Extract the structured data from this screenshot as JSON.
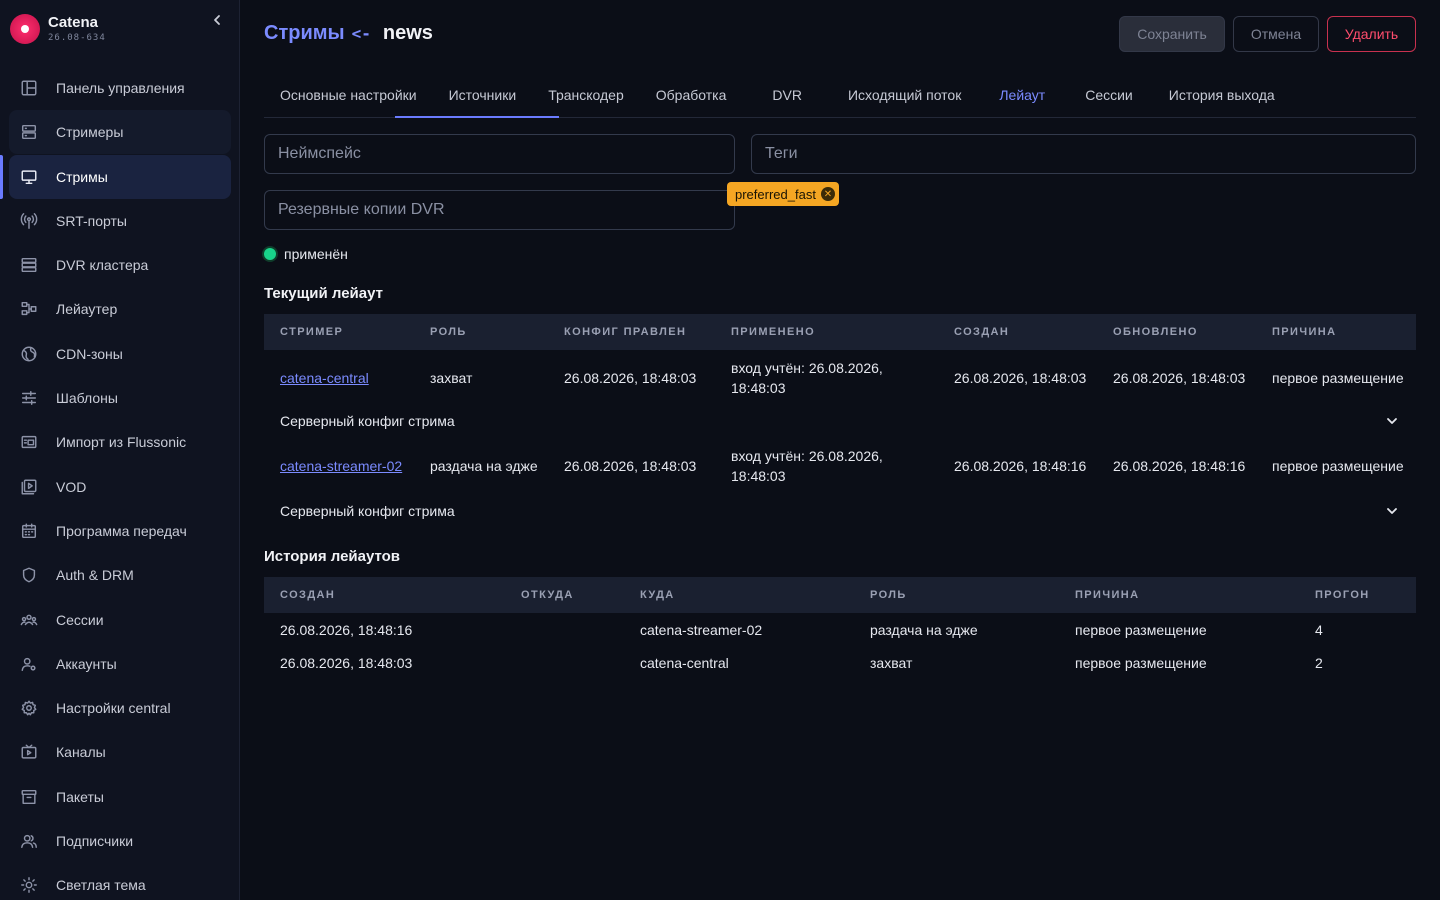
{
  "brand": {
    "name": "Catena",
    "version": "26.08-634"
  },
  "sidebar": {
    "items": [
      {
        "label": "Панель управления",
        "icon": "dashboard-icon"
      },
      {
        "label": "Стримеры",
        "icon": "servers-icon"
      },
      {
        "label": "Стримы",
        "icon": "monitor-icon"
      },
      {
        "label": "SRT-порты",
        "icon": "antenna-icon"
      },
      {
        "label": "DVR кластера",
        "icon": "storage-icon"
      },
      {
        "label": "Лейаутер",
        "icon": "layout-icon"
      },
      {
        "label": "CDN-зоны",
        "icon": "globe-icon"
      },
      {
        "label": "Шаблоны",
        "icon": "sliders-icon"
      },
      {
        "label": "Импорт из Flussonic",
        "icon": "import-icon"
      },
      {
        "label": "VOD",
        "icon": "vod-icon"
      },
      {
        "label": "Программа передач",
        "icon": "calendar-icon"
      },
      {
        "label": "Auth & DRM",
        "icon": "shield-icon"
      },
      {
        "label": "Сессии",
        "icon": "people-icon"
      },
      {
        "label": "Аккаунты",
        "icon": "account-icon"
      },
      {
        "label": "Настройки central",
        "icon": "gear-icon"
      },
      {
        "label": "Каналы",
        "icon": "tv-icon"
      },
      {
        "label": "Пакеты",
        "icon": "archive-icon"
      },
      {
        "label": "Подписчики",
        "icon": "subscribers-icon"
      },
      {
        "label": "Светлая тема",
        "icon": "sun-icon"
      }
    ]
  },
  "header": {
    "breadcrumb": "Стримы",
    "arrow": "<-",
    "stream_name": "news",
    "save_label": "Сохранить",
    "cancel_label": "Отмена",
    "delete_label": "Удалить"
  },
  "tabs": [
    "Основные настройки",
    "Источники",
    "Транскодер",
    "Обработка",
    "DVR",
    "Исходящий поток",
    "Лейаут",
    "Сессии",
    "История выхода"
  ],
  "form": {
    "namespace_placeholder": "Неймспейс",
    "dvr_backup_placeholder": "Резервные копии DVR",
    "tags_placeholder": "Теги",
    "tag": "preferred_fast"
  },
  "status": {
    "label": "применён"
  },
  "current_layout": {
    "title": "Текущий лейаут",
    "columns": [
      "Стример",
      "Роль",
      "Конфиг правлен",
      "Применено",
      "Создан",
      "Обновлено",
      "Причина"
    ],
    "rows": [
      {
        "streamer": "catena-central",
        "role": "захват",
        "config_edited": "26.08.2026, 18:48:03",
        "applied": "вход учтён: 26.08.2026, 18:48:03",
        "created": "26.08.2026, 18:48:03",
        "updated": "26.08.2026, 18:48:03",
        "reason": "первое размещение",
        "expander": "Серверный конфиг стрима"
      },
      {
        "streamer": "catena-streamer-02",
        "role": "раздача на эдже",
        "config_edited": "26.08.2026, 18:48:03",
        "applied": "вход учтён: 26.08.2026, 18:48:03",
        "created": "26.08.2026, 18:48:16",
        "updated": "26.08.2026, 18:48:16",
        "reason": "первое размещение",
        "expander": "Серверный конфиг стрима"
      }
    ]
  },
  "layout_history": {
    "title": "История лейаутов",
    "columns": [
      "Создан",
      "Откуда",
      "Куда",
      "Роль",
      "Причина",
      "Прогон"
    ],
    "rows": [
      {
        "created": "26.08.2026, 18:48:16",
        "from": "",
        "to": "catena-streamer-02",
        "role": "раздача на эдже",
        "reason": "первое размещение",
        "run": "4"
      },
      {
        "created": "26.08.2026, 18:48:03",
        "from": "",
        "to": "catena-central",
        "role": "захват",
        "reason": "первое размещение",
        "run": "2"
      }
    ]
  },
  "colors": {
    "accent": "#6a7bff",
    "danger": "#ff4d6d",
    "tag": "#f5a623",
    "ok": "#18d38a"
  }
}
